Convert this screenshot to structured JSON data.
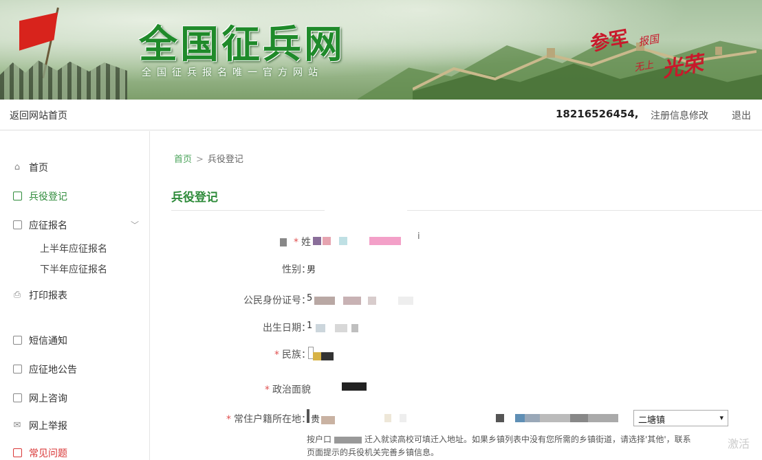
{
  "banner": {
    "title": "全国征兵网",
    "subtitle": "全国征兵报名唯一官方网站",
    "slogan_a": "参军",
    "slogan_b": "报国",
    "slogan_c": "无上",
    "slogan_d": "光荣"
  },
  "topbar": {
    "back_label": "返回网站首页",
    "phone": "18216526454,",
    "edit_label": "注册信息修改",
    "logout_label": "退出"
  },
  "sidebar": {
    "items": [
      {
        "label": "首页",
        "icon": "home-icon"
      },
      {
        "label": "兵役登记",
        "icon": "clipboard-icon"
      },
      {
        "label": "应征报名",
        "icon": "form-icon"
      },
      {
        "label": "上半年应征报名"
      },
      {
        "label": "下半年应征报名"
      },
      {
        "label": "打印报表",
        "icon": "printer-icon"
      },
      {
        "label": "短信通知",
        "icon": "message-icon"
      },
      {
        "label": "应征地公告",
        "icon": "message-icon"
      },
      {
        "label": "网上咨询",
        "icon": "message-icon"
      },
      {
        "label": "网上举报",
        "icon": "mail-icon"
      },
      {
        "label": "常见问题",
        "icon": "question-icon"
      }
    ]
  },
  "breadcrumb": {
    "home": "首页",
    "sep": ">",
    "current": "兵役登记"
  },
  "page_title": "兵役登记",
  "form": {
    "name_label": "姓",
    "name_val": "i",
    "gender_label": "性别：",
    "gender_val": "男",
    "id_label": "公民身份证号：",
    "id_val": "5",
    "birth_label": "出生日期：",
    "birth_val": "1",
    "ethnic_label": "民族：",
    "political_label": "政治面貌",
    "residence_label": "常住户籍所在地：",
    "residence_val": "贵",
    "town_select": "二塘镇",
    "hint_1": "按户口",
    "hint_2": "迁入就读高校可填迁入地址。如果乡镇列表中没有您所需的乡镇街道，请选择'其他'，联系",
    "hint_3": "页面提示的兵役机关完善乡镇信息。"
  },
  "watermark": "激活"
}
